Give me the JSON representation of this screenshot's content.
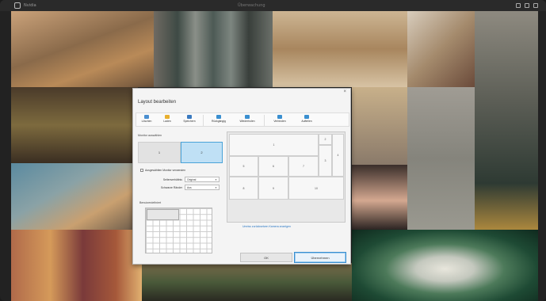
{
  "titlebar": {
    "app_title": "Nvidia",
    "window_title": "Überwachung",
    "controls": [
      "minimize-icon",
      "maximize-icon",
      "close-icon"
    ]
  },
  "dialog": {
    "title": "Layout bearbeiten",
    "close_glyph": "×",
    "toolbar": [
      {
        "label": "Löschen",
        "icon": "delete-icon",
        "color": "#4a8fd0"
      },
      {
        "label": "Laden",
        "icon": "folder-icon",
        "color": "#e8b030"
      },
      {
        "label": "Speichern",
        "icon": "save-icon",
        "color": "#3a7ac0"
      },
      {
        "label": "Rückgängig",
        "icon": "undo-icon",
        "color": "#3a8fd0"
      },
      {
        "label": "Wiederholen",
        "icon": "redo-icon",
        "color": "#3a8fd0"
      },
      {
        "label": "Verbinden",
        "icon": "merge-icon",
        "color": "#3a8fd0"
      },
      {
        "label": "Aufteilen",
        "icon": "split-icon",
        "color": "#3a8fd0"
      }
    ],
    "monitors_label": "Monitor auswählen",
    "monitors": [
      "1",
      "2"
    ],
    "selected_monitor": "2",
    "checkbox_label": "Ausgewählten Monitor verwenden",
    "fields": [
      {
        "label": "Seitenverhältnis",
        "value": "Original"
      },
      {
        "label": "Schwarze Ränder",
        "value": "Aus"
      }
    ],
    "custom_grid_label": "Benutzerdefiniert",
    "preview_cells": [
      "1",
      "2",
      "3",
      "4",
      "5",
      "6",
      "7",
      "8",
      "9",
      "10"
    ],
    "link_text": "Umriss zurücksetzen Kamera anzeigen",
    "ok_label": "OK",
    "apply_label": "Übernehmen"
  }
}
